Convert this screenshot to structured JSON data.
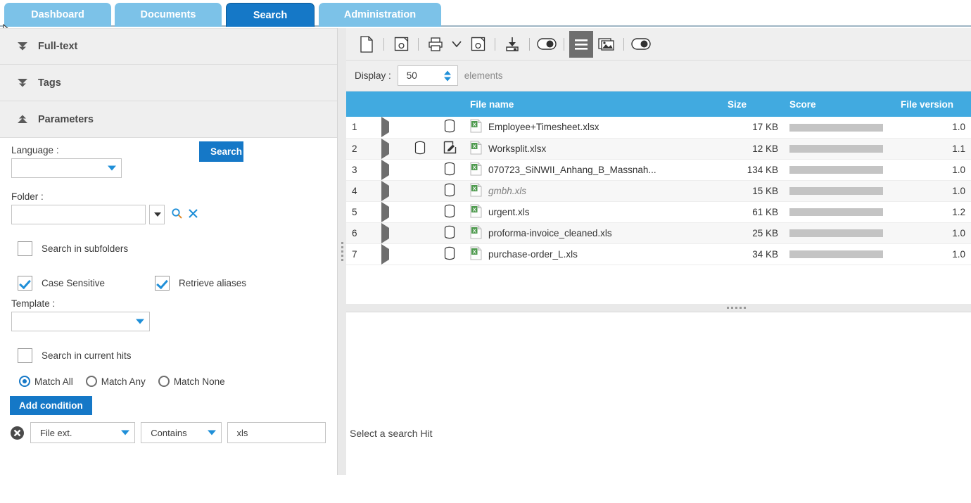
{
  "tabs": [
    {
      "label": "Dashboard",
      "active": false
    },
    {
      "label": "Documents",
      "active": false
    },
    {
      "label": "Search",
      "active": true
    },
    {
      "label": "Administration",
      "active": false
    }
  ],
  "colors": {
    "tab_active": "#1578c7",
    "tab_inactive": "#7cc2e8",
    "table_header": "#41aae0",
    "accent": "#1578c7",
    "score_bar": "#c4c4c4"
  },
  "sidebar": {
    "sections": [
      {
        "title": "Full-text",
        "expanded": false,
        "icon": "chevron-double-down-icon"
      },
      {
        "title": "Tags",
        "expanded": false,
        "icon": "chevron-double-down-icon"
      },
      {
        "title": "Parameters",
        "expanded": true,
        "icon": "chevron-double-up-icon"
      }
    ],
    "parameters": {
      "language_label": "Language :",
      "language_value": "",
      "search_button": "Search",
      "folder_label": "Folder :",
      "folder_value": "",
      "folder_placeholder": "",
      "folder_browse_icon": "search-magnifier-icon",
      "folder_clear_icon": "close-x-icon",
      "search_in_subfolders": {
        "label": "Search in subfolders",
        "checked": false
      },
      "case_sensitive": {
        "label": "Case Sensitive",
        "checked": true
      },
      "retrieve_aliases": {
        "label": "Retrieve aliases",
        "checked": true
      },
      "template_label": "Template :",
      "template_value": "",
      "search_in_current_hits": {
        "label": "Search in current hits",
        "checked": false
      },
      "match_options": [
        {
          "label": "Match All",
          "selected": true
        },
        {
          "label": "Match Any",
          "selected": false
        },
        {
          "label": "Match None",
          "selected": false
        }
      ],
      "add_condition_button": "Add condition",
      "condition_row": {
        "remove_icon": "remove-circle-x-icon",
        "field": "File ext.",
        "operator": "Contains",
        "value": "xls"
      }
    }
  },
  "toolbar": {
    "buttons": [
      {
        "name": "new-document-icon",
        "active": false
      },
      {
        "sep": true
      },
      {
        "name": "save-icon",
        "active": false
      },
      {
        "sep": true
      },
      {
        "name": "print-icon",
        "active": false
      },
      {
        "name": "chevron-down-icon",
        "active": false
      },
      {
        "name": "save-as-icon",
        "active": false
      },
      {
        "sep": true
      },
      {
        "name": "import-download-icon",
        "active": false
      },
      {
        "sep": true
      },
      {
        "name": "toggle-switch-icon",
        "active": false
      },
      {
        "sep": true
      },
      {
        "name": "list-view-icon",
        "active": true
      },
      {
        "name": "gallery-view-icon",
        "active": false
      },
      {
        "sep": true
      },
      {
        "name": "toggle-switch-2-icon",
        "active": false
      }
    ]
  },
  "display_bar": {
    "label": "Display :",
    "value": "50",
    "suffix": "elements"
  },
  "results_table": {
    "columns": [
      "",
      "",
      "",
      "File name",
      "Size",
      "Score",
      "File version"
    ],
    "header": {
      "file_name": "File name",
      "size": "Size",
      "score": "Score",
      "file_version": "File version"
    },
    "rows": [
      {
        "num": "1",
        "icons": [
          "database-icon"
        ],
        "file_icon": "excel-file-icon",
        "name": "Employee+Timesheet.xlsx",
        "italic": false,
        "size": "17 KB",
        "score": 100,
        "version": "1.0"
      },
      {
        "num": "2",
        "icons": [
          "database-icon",
          "edit-pencil-icon"
        ],
        "file_icon": "excel-file-icon",
        "name": "Worksplit.xlsx",
        "italic": false,
        "size": "12 KB",
        "score": 100,
        "version": "1.1"
      },
      {
        "num": "3",
        "icons": [
          "database-icon"
        ],
        "file_icon": "excel-file-icon",
        "name": "070723_SiNWII_Anhang_B_Massnah...",
        "italic": false,
        "size": "134 KB",
        "score": 100,
        "version": "1.0"
      },
      {
        "num": "4",
        "icons": [
          "database-icon"
        ],
        "file_icon": "excel-file-icon",
        "name": "gmbh.xls",
        "italic": true,
        "size": "15 KB",
        "score": 100,
        "version": "1.0"
      },
      {
        "num": "5",
        "icons": [
          "database-icon"
        ],
        "file_icon": "excel-file-icon",
        "name": "urgent.xls",
        "italic": false,
        "size": "61 KB",
        "score": 100,
        "version": "1.2"
      },
      {
        "num": "6",
        "icons": [
          "database-icon"
        ],
        "file_icon": "excel-file-icon",
        "name": "proforma-invoice_cleaned.xls",
        "italic": false,
        "size": "25 KB",
        "score": 100,
        "version": "1.0"
      },
      {
        "num": "7",
        "icons": [
          "database-icon"
        ],
        "file_icon": "excel-file-icon",
        "name": "purchase-order_L.xls",
        "italic": false,
        "size": "34 KB",
        "score": 100,
        "version": "1.0"
      }
    ]
  },
  "preview": {
    "message": "Select a search Hit"
  }
}
